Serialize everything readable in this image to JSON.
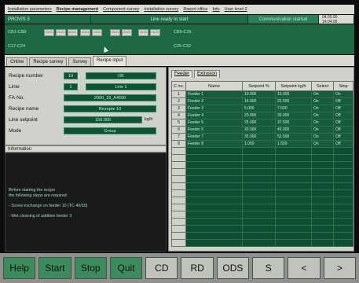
{
  "menu": [
    "Installation parameters",
    "Recipe management",
    "Component survey",
    "Installation survey",
    "Report office",
    "Info",
    "User level 2"
  ],
  "status": {
    "process": "PROVIS 3",
    "ready": "Line ready to start",
    "communication": "Communication started",
    "time": "04.05.00 14:04:05"
  },
  "stations": [
    "CB1-CB8",
    "C17-C24",
    "CB9-C16",
    "C25-C32"
  ],
  "tabs": [
    "Online",
    "Recipe survey",
    "Survey",
    "Recipe input"
  ],
  "form": {
    "recipe_number_label": "Recipe number",
    "recipe_number": "10",
    "recipe_status": "OK",
    "line_label": "Linie",
    "line_number": "1",
    "line_name": "Line 1",
    "fa_label": "FA-No.",
    "fa_value": "2000_18_A4500",
    "recipe_name_label": "Recipe name",
    "recipe_name": "Rezepte 10",
    "setpoint_label": "Line setpoint",
    "setpoint_value": "150.000",
    "setpoint_unit": "kg/h",
    "mode_label": "Mode",
    "mode_value": "Group"
  },
  "info": {
    "title": "Information",
    "lines": [
      "Before starting the recipe",
      "the following steps are required:",
      "",
      "- Screw exchange on feeder 10 (TC 40/50)",
      "",
      "- Wet cleaning of additive feeder 3"
    ]
  },
  "subtabs": [
    "Feeder",
    "Extrusion"
  ],
  "table": {
    "headers": [
      "C no.",
      "Name",
      "Setpoint %",
      "Setpoint kg/h",
      "Select",
      "Stop"
    ],
    "rows": [
      [
        "1",
        "Feeder 1",
        "10.000",
        "15.000",
        "On",
        "On"
      ],
      [
        "2",
        "Feeder 2",
        "15.000",
        "22.500",
        "On",
        "Off"
      ],
      [
        "3",
        "Feeder 3",
        "5.000",
        "7.500",
        "On",
        "Off"
      ],
      [
        "4",
        "Feeder 4",
        "20.000",
        "30.000",
        "On",
        "Off"
      ],
      [
        "5",
        "Feeder 5",
        "25.000",
        "37.500",
        "On",
        "Off"
      ],
      [
        "6",
        "Feeder 6",
        "30.000",
        "45.000",
        "On",
        "Off"
      ],
      [
        "7",
        "Feeder 7",
        "35.000",
        "52.500",
        "On",
        "Off"
      ],
      [
        "8",
        "Feeder 8",
        "1.000",
        "1.500",
        "On",
        "Off"
      ]
    ]
  },
  "buttons": [
    "Help",
    "Start",
    "Stop",
    "Quit",
    "CD",
    "RD",
    "ODS",
    "S",
    "<",
    ">"
  ]
}
